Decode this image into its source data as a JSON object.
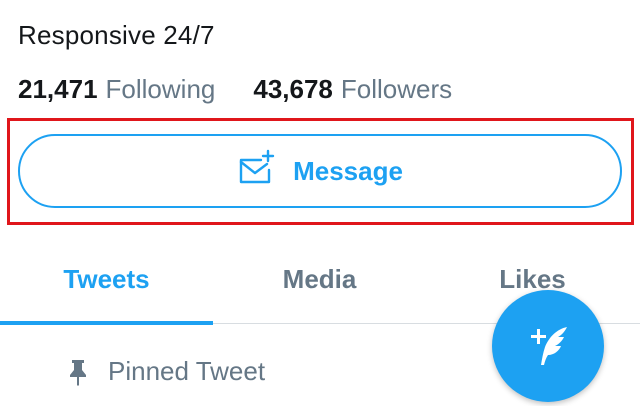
{
  "profile": {
    "bio": "Responsive 24/7",
    "following_count": "21,471",
    "following_label": "Following",
    "followers_count": "43,678",
    "followers_label": "Followers"
  },
  "actions": {
    "message_label": "Message",
    "message_icon": "envelope-plus-icon"
  },
  "tabs": [
    {
      "label": "Tweets",
      "active": true
    },
    {
      "label": "Media",
      "active": false
    },
    {
      "label": "Likes",
      "active": false
    }
  ],
  "pinned": {
    "label": "Pinned Tweet",
    "icon": "pin-icon"
  },
  "fab": {
    "icon": "compose-tweet-icon"
  },
  "colors": {
    "accent": "#1da1f2",
    "text": "#14171a",
    "secondary_text": "#657786",
    "highlight": "#e0161b"
  }
}
